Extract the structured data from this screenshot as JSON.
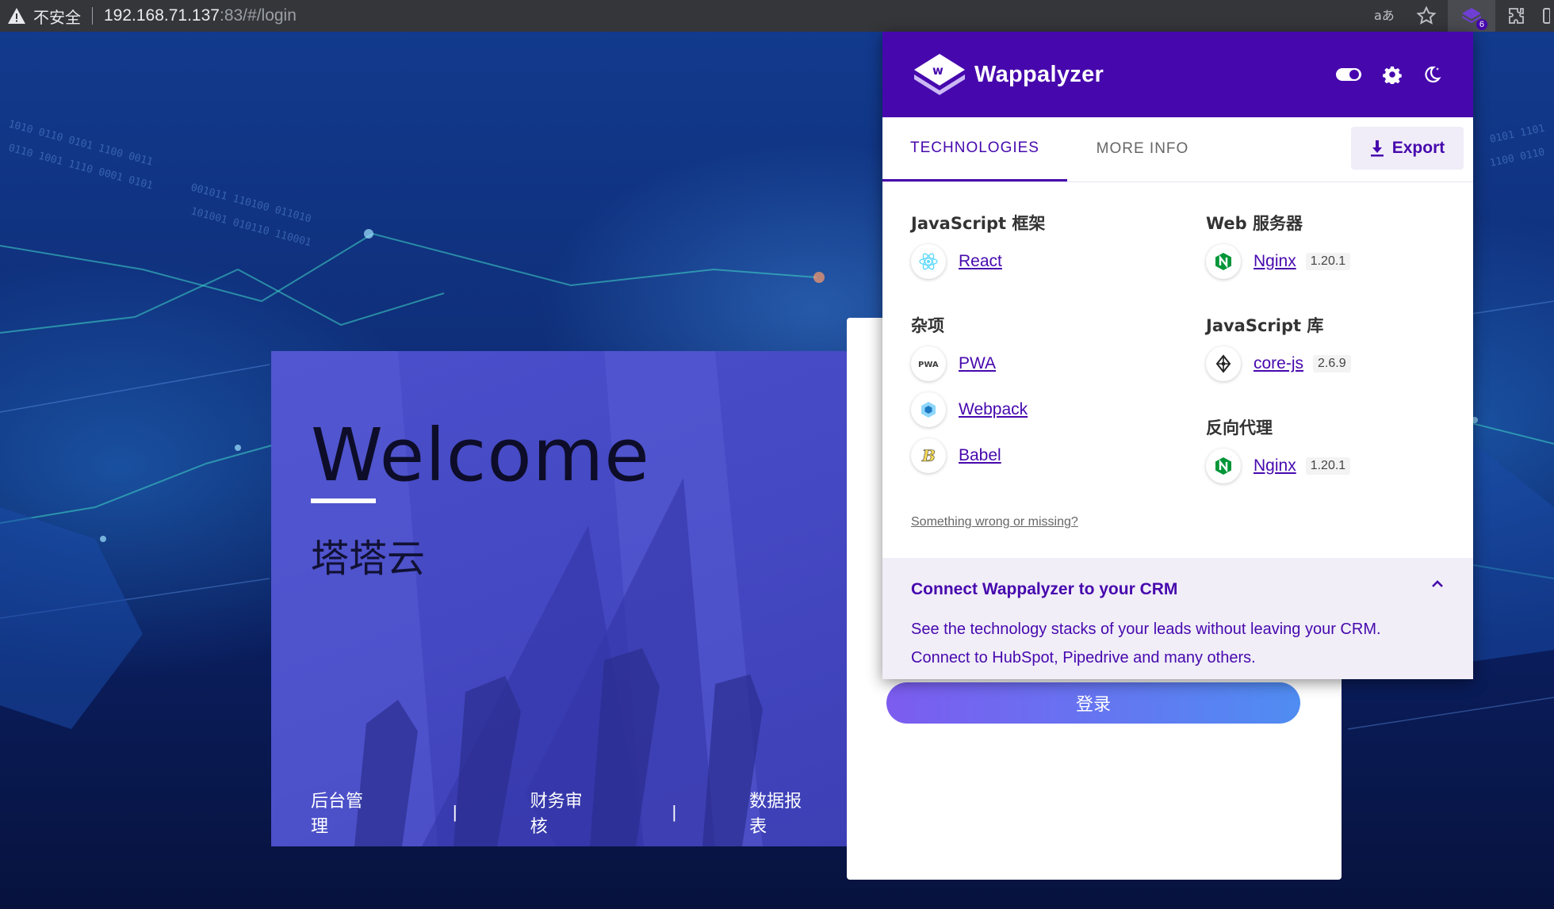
{
  "browser": {
    "security_label": "不安全",
    "url_host": "192.168.71.137",
    "url_path": ":83/#/login",
    "extension_badge": "6",
    "icons": [
      "warning-icon",
      "translate-icon",
      "star-icon",
      "wappalyzer-extension-icon",
      "puzzle-icon"
    ]
  },
  "welcome": {
    "title": "Welcome",
    "subtitle": "塔塔云",
    "links": [
      "后台管理",
      "|",
      "财务审核",
      "|",
      "数据报表"
    ]
  },
  "login": {
    "submit_label": "登录"
  },
  "wappalyzer": {
    "brand": "Wappalyzer",
    "tabs": {
      "technologies": "TECHNOLOGIES",
      "more_info": "MORE INFO"
    },
    "export_label": "Export",
    "categories": [
      {
        "title": "JavaScript 框架",
        "items": [
          {
            "name": "React",
            "version": ""
          }
        ]
      },
      {
        "title": "杂项",
        "items": [
          {
            "name": "PWA",
            "version": ""
          },
          {
            "name": "Webpack",
            "version": ""
          },
          {
            "name": "Babel",
            "version": ""
          }
        ]
      },
      {
        "title": "Web 服务器",
        "items": [
          {
            "name": "Nginx",
            "version": "1.20.1"
          }
        ]
      },
      {
        "title": "JavaScript 库",
        "items": [
          {
            "name": "core-js",
            "version": "2.6.9"
          }
        ]
      },
      {
        "title": "反向代理",
        "items": [
          {
            "name": "Nginx",
            "version": "1.20.1"
          }
        ]
      }
    ],
    "report_link": "Something wrong or missing?",
    "crm": {
      "title": "Connect Wappalyzer to your CRM",
      "text": "See the technology stacks of your leads without leaving your CRM. Connect to HubSpot, Pipedrive and many others."
    },
    "colors": {
      "brand": "#4608ad",
      "nginx": "#009639",
      "react": "#61dafb"
    }
  }
}
